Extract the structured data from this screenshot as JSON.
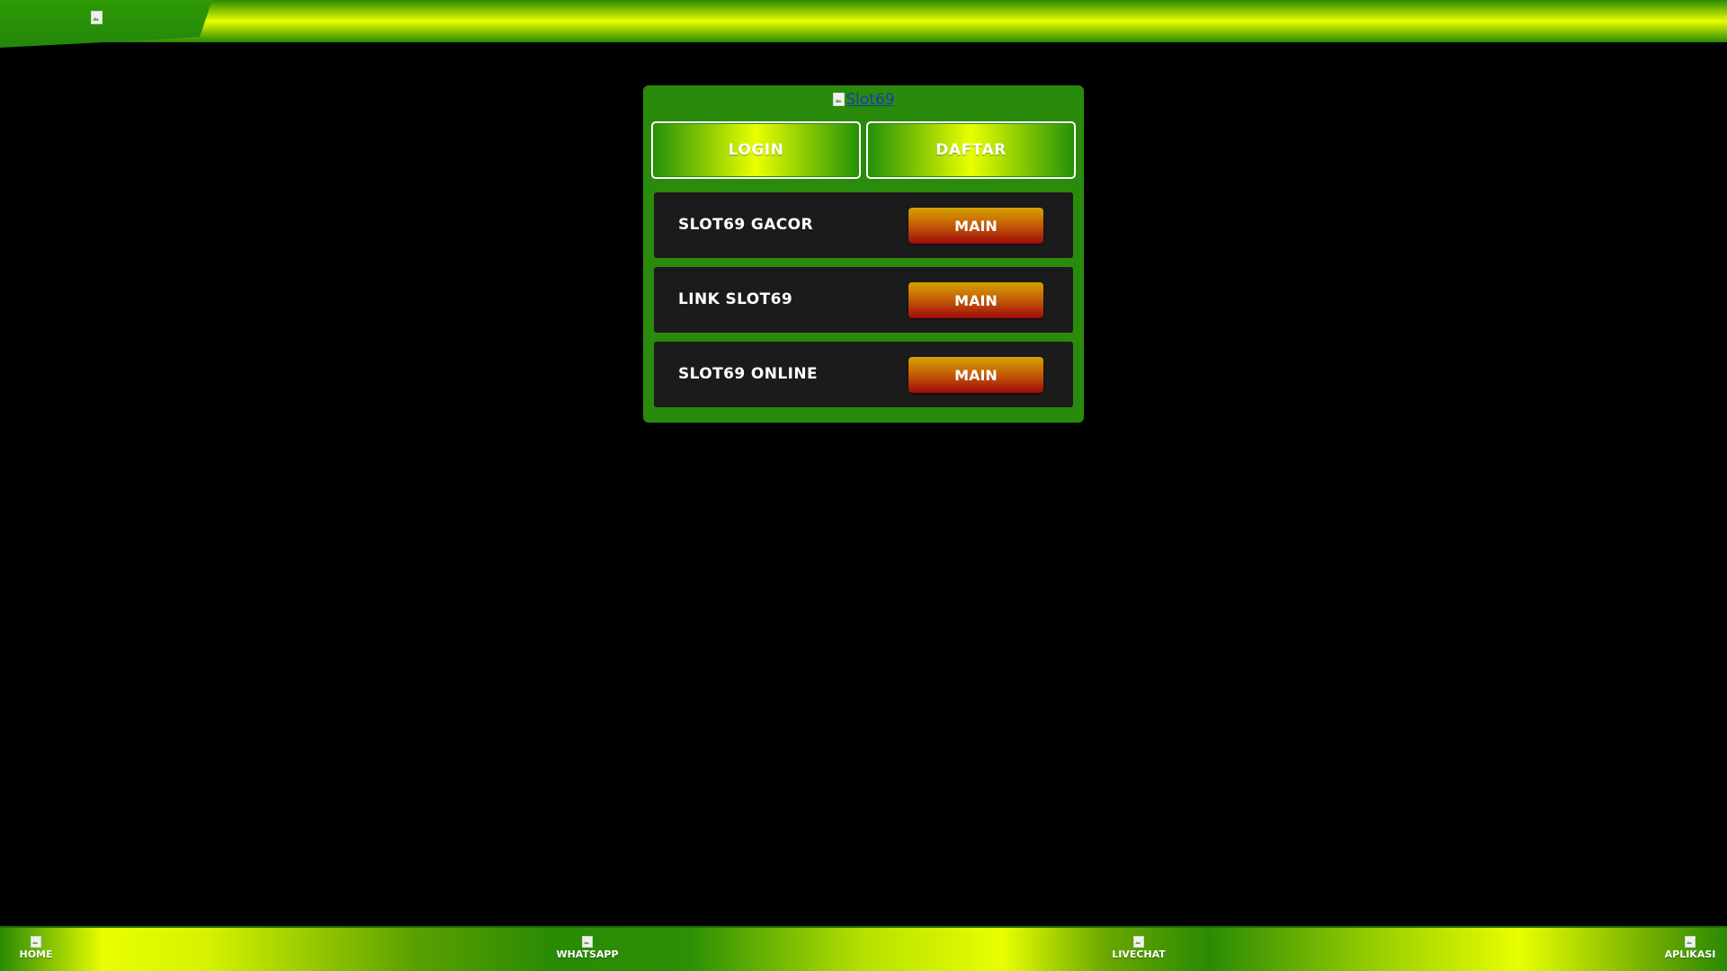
{
  "header": {
    "logo_alt": ""
  },
  "card": {
    "logo_alt": "Slot69",
    "login_label": "LOGIN",
    "daftar_label": "DAFTAR",
    "games": [
      {
        "name": "SLOT69 GACOR",
        "button": "MAIN"
      },
      {
        "name": "LINK SLOT69",
        "button": "MAIN"
      },
      {
        "name": "SLOT69 ONLINE",
        "button": "MAIN"
      }
    ]
  },
  "bottom_nav": {
    "items": [
      {
        "label": "HOME",
        "icon": "home-icon"
      },
      {
        "label": "WHATSAPP",
        "icon": "whatsapp-icon"
      },
      {
        "label": "LIVECHAT",
        "icon": "livechat-icon"
      },
      {
        "label": "APLIKASI",
        "icon": "app-download-icon"
      }
    ]
  },
  "colors": {
    "background": "#000000",
    "card_green": "#2a8a0c",
    "lime": "#e8ff00",
    "row_dark": "#1b1b1b",
    "main_button_top": "#d6a200",
    "main_button_bottom": "#9e0a0a",
    "link_blue": "#1a3bb0"
  }
}
